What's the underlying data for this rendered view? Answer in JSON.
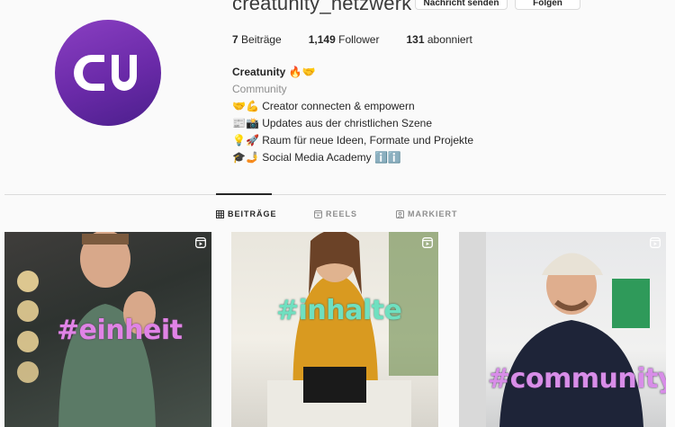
{
  "profile": {
    "username": "creatunity_netzwerk",
    "message_button": "Nachricht senden",
    "follow_button": "Folgen",
    "more": "···",
    "stats": {
      "posts_count": "7",
      "posts_label": "Beiträge",
      "followers_count": "1,149",
      "followers_label": "Follower",
      "following_count": "131",
      "following_label": "abonniert"
    },
    "bio": {
      "name": "Creatunity 🔥🤝",
      "category": "Community",
      "line1": "🤝💪 Creator connecten & empowern",
      "line2": "📰📸 Updates aus der christlichen Szene",
      "line3": "💡🚀 Raum für neue Ideen, Formate und Projekte",
      "line4": "🎓🤳 Social Media Academy ℹ️ℹ️"
    },
    "colors": {
      "avatar_gradient_start": "#8a3fc2",
      "avatar_gradient_end": "#4b1f8c"
    }
  },
  "tabs": {
    "posts": "BEITRÄGE",
    "reels": "REELS",
    "tagged": "MARKIERT"
  },
  "grid": [
    {
      "hashtag": "#einheit",
      "icon": "reel-icon"
    },
    {
      "hashtag": "#inhalte",
      "icon": "reel-icon"
    },
    {
      "hashtag": "#community",
      "icon": "reel-icon"
    }
  ]
}
